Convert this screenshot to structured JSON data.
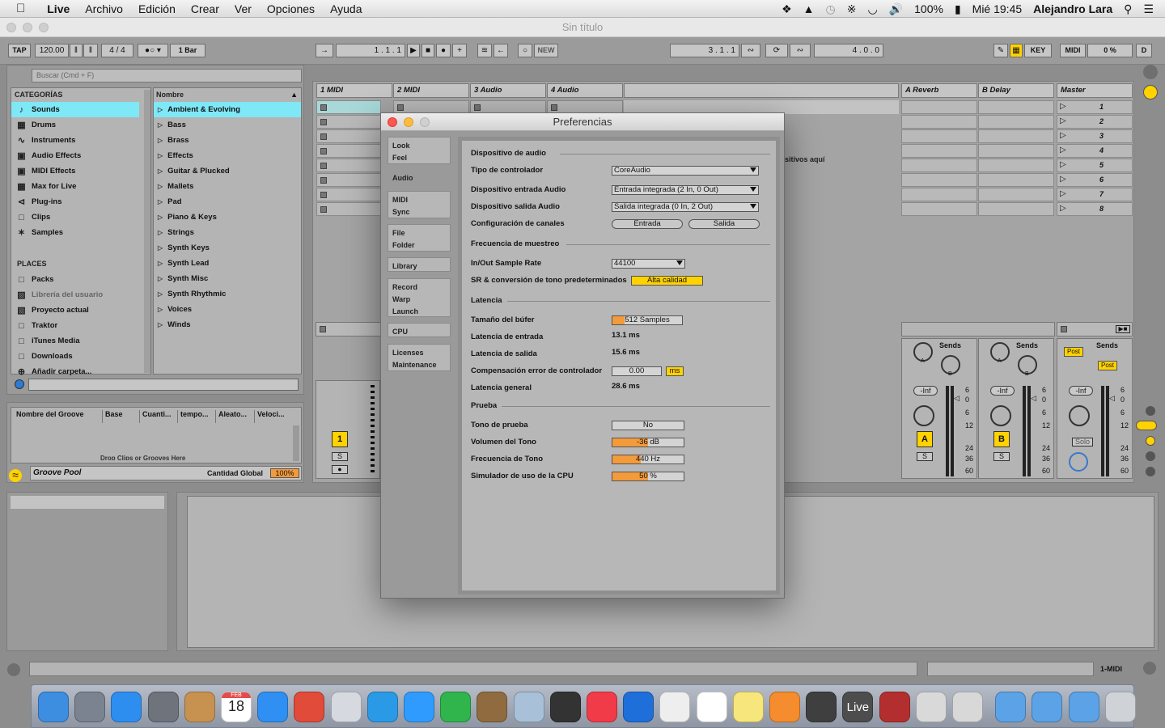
{
  "menubar": {
    "apple": "",
    "app": "Live",
    "items": [
      "Archivo",
      "Edición",
      "Crear",
      "Ver",
      "Opciones",
      "Ayuda"
    ],
    "battery": "100%",
    "clock": "Mié 19:45",
    "user": "Alejandro Lara"
  },
  "window": {
    "title": "Sin título"
  },
  "transport": {
    "tap": "TAP",
    "bpm": "120.00",
    "sig": "4 / 4",
    "quant": "1 Bar",
    "pos1": "1 .   1 .   1",
    "new": "NEW",
    "pos2": "3 .   1 .   1",
    "pos3": "4 .   0 .   0",
    "key": "KEY",
    "midi": "MIDI",
    "cpu": "0 %",
    "d": "D"
  },
  "browser": {
    "search_placeholder": "Buscar (Cmd + F)",
    "categories_header": "CATEGORÍAS",
    "categories": [
      "Sounds",
      "Drums",
      "Instruments",
      "Audio Effects",
      "MIDI Effects",
      "Max for Live",
      "Plug-ins",
      "Clips",
      "Samples"
    ],
    "places_header": "PLACES",
    "places": [
      "Packs",
      "Librería del usuario",
      "Proyecto actual",
      "Traktor",
      "iTunes Media",
      "Downloads",
      "Añadir carpeta..."
    ],
    "name_header": "Nombre",
    "items": [
      "Ambient & Evolving",
      "Bass",
      "Brass",
      "Effects",
      "Guitar & Plucked",
      "Mallets",
      "Pad",
      "Piano & Keys",
      "Strings",
      "Synth Keys",
      "Synth Lead",
      "Synth Misc",
      "Synth Rhythmic",
      "Voices",
      "Winds"
    ]
  },
  "groove": {
    "cols": [
      "Nombre del Groove",
      "Base",
      "Cuanti...",
      "tempo...",
      "Aleato...",
      "Veloci..."
    ],
    "hint": "Drop Clips or Grooves Here",
    "pool": "Groove Pool",
    "global_label": "Cantidad Global",
    "global_value": "100%"
  },
  "tracks": [
    "1 MIDI",
    "2 MIDI",
    "3 Audio",
    "4 Audio"
  ],
  "returns": [
    "A Reverb",
    "B Delay"
  ],
  "master": {
    "name": "Master",
    "scenes": [
      "1",
      "2",
      "3",
      "4",
      "5",
      "6",
      "7",
      "8"
    ]
  },
  "drop_hint": "sitivos aquí",
  "mixer": {
    "sends": "Sends",
    "post": "Post",
    "inf": "-Inf",
    "solo": "Solo",
    "a": "A",
    "b": "B",
    "s": "S",
    "one": "1",
    "scale": [
      "6",
      "0",
      "6",
      "12",
      "24",
      "36",
      "60"
    ]
  },
  "status": {
    "track": "1-MIDI"
  },
  "prefs": {
    "title": "Preferencias",
    "tabs": [
      [
        "Look",
        "Feel"
      ],
      [
        "Audio"
      ],
      [
        "MIDI",
        "Sync"
      ],
      [
        "File",
        "Folder"
      ],
      [
        "Library"
      ],
      [
        "Record",
        "Warp",
        "Launch"
      ],
      [
        "CPU"
      ],
      [
        "Licenses",
        "Maintenance"
      ]
    ],
    "sec_device": "Dispositivo de audio",
    "driver_label": "Tipo de controlador",
    "driver": "CoreAudio",
    "in_label": "Dispositivo entrada Audio",
    "in": "Entrada integrada (2 In, 0 Out)",
    "out_label": "Dispositivo salida Audio",
    "out": "Salida integrada (0 In, 2 Out)",
    "chan_label": "Configuración de canales",
    "chan_in": "Entrada",
    "chan_out": "Salida",
    "sec_rate": "Frecuencia de muestreo",
    "rate_label": "In/Out Sample Rate",
    "rate": "44100",
    "src_label": "SR & conversión de tono predeterminados",
    "src": "Alta calidad",
    "sec_lat": "Latencia",
    "buf_label": "Tamaño del búfer",
    "buf": "512 Samples",
    "buf_fraction": 0.18,
    "inlat_label": "Latencia de entrada",
    "inlat": "13.1 ms",
    "outlat_label": "Latencia de salida",
    "outlat": "15.6 ms",
    "comp_label": "Compensación error de controlador",
    "comp": "0.00",
    "comp_unit": "ms",
    "total_label": "Latencia general",
    "total": "28.6 ms",
    "sec_test": "Prueba",
    "tone_label": "Tono de prueba",
    "tone": "No",
    "vol_label": "Volumen del Tono",
    "vol": "-36 dB",
    "vol_fraction": 0.5,
    "freq_label": "Frecuencia de Tono",
    "freq": "440 Hz",
    "freq_fraction": 0.4,
    "cpu_label": "Simulador de uso de la CPU",
    "cpu": "50 %",
    "cpu_fraction": 0.5
  },
  "dock": {
    "calendar_month": "FEB",
    "calendar_day": "18",
    "live": "Live"
  },
  "colors": {
    "accent": "#ffd200",
    "orange": "#f39a3b",
    "highlight": "#7fe8f6"
  }
}
